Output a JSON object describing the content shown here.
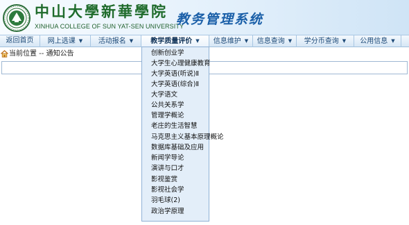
{
  "header": {
    "school_name": "中山大學新華學院",
    "school_name_en": "XINHUA COLLEGE OF SUN YAT-SEN UNIVERSITY",
    "system_name": "教务管理系统"
  },
  "nav": {
    "items": [
      {
        "label": "返回首页",
        "caret": ""
      },
      {
        "label": "网上选课",
        "caret": "▼"
      },
      {
        "label": "活动报名",
        "caret": "▼"
      },
      {
        "label": "教学质量评价",
        "caret": "▼"
      },
      {
        "label": "信息维护",
        "caret": "▼"
      },
      {
        "label": "信息查询",
        "caret": "▼"
      },
      {
        "label": "学分币查询",
        "caret": "▼"
      },
      {
        "label": "公用信息",
        "caret": "▼"
      }
    ]
  },
  "breadcrumb": {
    "text": "当前位置 -- 通知公告"
  },
  "dropdown": {
    "items": [
      "创新创业学",
      "大学生心理健康教育",
      "大学英语(听说)Ⅱ",
      "大学英语(综合)Ⅱ",
      "大学语文",
      "公共关系学",
      "管理学概论",
      "老庄的生活智慧",
      "马克思主义基本原理概论",
      "数据库基础及应用",
      "新闻学导论",
      "演讲与口才",
      "影视鉴赏",
      "影视社会学",
      "羽毛球(2)",
      "政治学原理"
    ]
  }
}
